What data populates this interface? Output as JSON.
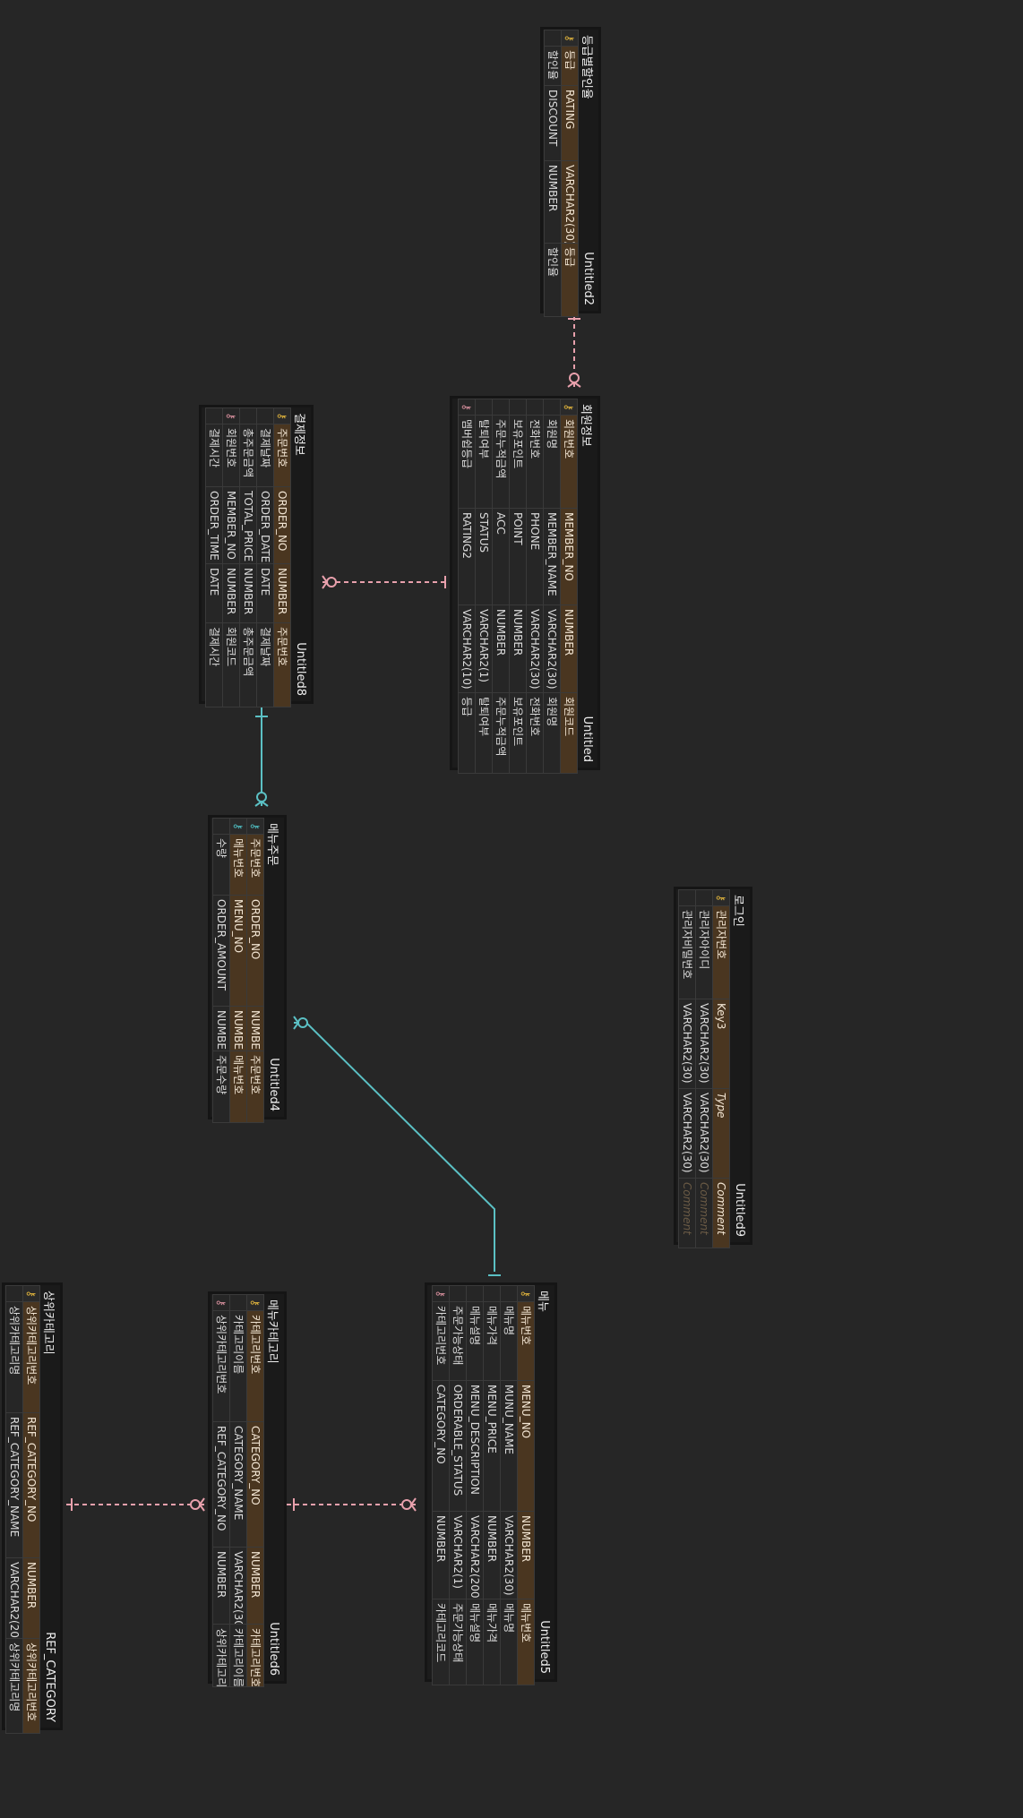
{
  "colors": {
    "background": "#262626",
    "pk_row": "#4a3620",
    "link_pink": "#e8a0ac",
    "link_teal": "#5bc0c4"
  },
  "entities": {
    "rating": {
      "title": "등급별할인율",
      "label": "Untitled2",
      "rows": [
        {
          "key": "key-gold",
          "col1": "등급",
          "col2": "RATING",
          "col3": "VARCHAR2(30)",
          "col4": "등급",
          "pk": true
        },
        {
          "key": "",
          "col1": "할인율",
          "col2": "DISCOUNT",
          "col3": "NUMBER",
          "col4": "할인율",
          "pk": false
        }
      ]
    },
    "member": {
      "title": "회원정보",
      "label": "Untitled",
      "rows": [
        {
          "key": "key-gold",
          "col1": "회원번호",
          "col2": "MEMBER_NO",
          "col3": "NUMBER",
          "col4": "회원코드",
          "pk": true
        },
        {
          "key": "",
          "col1": "회원명",
          "col2": "MEMBER_NAME",
          "col3": "VARCHAR2(30)",
          "col4": "회원명",
          "pk": false
        },
        {
          "key": "",
          "col1": "전화번호",
          "col2": "PHONE",
          "col3": "VARCHAR2(30)",
          "col4": "전화번호",
          "pk": false
        },
        {
          "key": "",
          "col1": "보유포인트",
          "col2": "POINT",
          "col3": "NUMBER",
          "col4": "보유포인트",
          "pk": false
        },
        {
          "key": "",
          "col1": "주문누적금액",
          "col2": "ACC",
          "col3": "NUMBER",
          "col4": "주문누적금액",
          "pk": false
        },
        {
          "key": "",
          "col1": "탈퇴여부",
          "col2": "STATUS",
          "col3": "VARCHAR2(1)",
          "col4": "탈퇴여부",
          "pk": false
        },
        {
          "key": "key-pink",
          "col1": "멤버쉽등급",
          "col2": "RATING2",
          "col3": "VARCHAR2(10)",
          "col4": "등급",
          "pk": false
        }
      ]
    },
    "payment": {
      "title": "결제정보",
      "label": "Untitled8",
      "rows": [
        {
          "key": "key-gold",
          "col1": "주문번호",
          "col2": "ORDER_NO",
          "col3": "NUMBER",
          "col4": "주문번호",
          "pk": true
        },
        {
          "key": "",
          "col1": "결제날짜",
          "col2": "ORDER_DATE",
          "col3": "DATE",
          "col4": "결제날짜",
          "pk": false
        },
        {
          "key": "",
          "col1": "총주문금액",
          "col2": "TOTAL_PRICE",
          "col3": "NUMBER",
          "col4": "총주문금액",
          "pk": false
        },
        {
          "key": "key-pink",
          "col1": "회원번호",
          "col2": "MEMBER_NO",
          "col3": "NUMBER",
          "col4": "회원코드",
          "pk": false
        },
        {
          "key": "",
          "col1": "결제시간",
          "col2": "ORDER_TIME",
          "col3": "DATE",
          "col4": "결제시간",
          "pk": false
        }
      ]
    },
    "menu_order": {
      "title": "메뉴주문",
      "label": "Untitled4",
      "rows": [
        {
          "key": "key-teal",
          "col1": "주문번호",
          "col2": "ORDER_NO",
          "col3": "NUMBER",
          "col4": "주문번호",
          "pk": true
        },
        {
          "key": "key-teal",
          "col1": "메뉴번호",
          "col2": "MENU_NO",
          "col3": "NUMBER",
          "col4": "메뉴번호",
          "pk": true
        },
        {
          "key": "",
          "col1": "수량",
          "col2": "ORDER_AMOUNT",
          "col3": "NUMBER",
          "col4": "주문수량",
          "pk": false
        }
      ]
    },
    "login": {
      "title": "로그인",
      "label": "Untitled9",
      "rows": [
        {
          "key": "key-gold",
          "col1": "관리자번호",
          "col2": "Key3",
          "col3": "Type",
          "col4": "Comment",
          "pk": true,
          "ph3": true,
          "ph4": true
        },
        {
          "key": "",
          "col1": "관리자아이디",
          "col2": "VARCHAR2(30)",
          "col3": "VARCHAR2(30)",
          "col4": "Comment",
          "pk": false,
          "ph4": true
        },
        {
          "key": "",
          "col1": "관리자비밀번호",
          "col2": "VARCHAR2(30)",
          "col3": "VARCHAR2(30)",
          "col4": "Comment",
          "pk": false,
          "ph4": true
        }
      ]
    },
    "menu": {
      "title": "메뉴",
      "label": "Untitled5",
      "rows": [
        {
          "key": "key-gold",
          "col1": "메뉴번호",
          "col2": "MENU_NO",
          "col3": "NUMBER",
          "col4": "메뉴번호",
          "pk": true
        },
        {
          "key": "",
          "col1": "메뉴명",
          "col2": "MUNU_NAME",
          "col3": "VARCHAR2(30)",
          "col4": "메뉴명",
          "pk": false
        },
        {
          "key": "",
          "col1": "메뉴가격",
          "col2": "MENU_PRICE",
          "col3": "NUMBER",
          "col4": "메뉴가격",
          "pk": false
        },
        {
          "key": "",
          "col1": "메뉴설명",
          "col2": "MENU_DESCRIPTION",
          "col3": "VARCHAR2(200)",
          "col4": "메뉴설명",
          "pk": false
        },
        {
          "key": "",
          "col1": "주문가능상태",
          "col2": "ORDERABLE_STATUS",
          "col3": "VARCHAR2(1)",
          "col4": "주문가능상태",
          "pk": false
        },
        {
          "key": "key-pink",
          "col1": "카테고리번호",
          "col2": "CATEGORY_NO",
          "col3": "NUMBER",
          "col4": "카테고리코드",
          "pk": false
        }
      ]
    },
    "menu_category": {
      "title": "메뉴카테고리",
      "label": "Untitled6",
      "rows": [
        {
          "key": "key-gold",
          "col1": "카테고리번호",
          "col2": "CATEGORY_NO",
          "col3": "NUMBER",
          "col4": "카테고리번호",
          "pk": true
        },
        {
          "key": "",
          "col1": "카테고리이름",
          "col2": "CATEGORY_NAME",
          "col3": "VARCHAR2(30)",
          "col4": "카테고리이름",
          "pk": false
        },
        {
          "key": "key-pink",
          "col1": "상위카테고리번호",
          "col2": "REF_CATEGORY_NO",
          "col3": "NUMBER",
          "col4": "상위카테고리번호",
          "pk": false
        }
      ]
    },
    "ref_category": {
      "title": "상위카테고리",
      "label": "REF_CATEGORY",
      "rows": [
        {
          "key": "key-gold",
          "col1": "상위카테고리번호",
          "col2": "REF_CATEGORY_NO",
          "col3": "NUMBER",
          "col4": "상위카테고리번호",
          "pk": true
        },
        {
          "key": "",
          "col1": "상위카테고리명",
          "col2": "REF_CATEGORY_NAME",
          "col3": "VARCHAR2(20)",
          "col4": "상위카테고리명",
          "pk": false
        }
      ]
    }
  },
  "relationships": [
    {
      "from": "rating",
      "to": "member",
      "style": "one-to-zero-or-many",
      "color": "#e8a0ac"
    },
    {
      "from": "member",
      "to": "payment",
      "style": "one-to-zero-or-many",
      "color": "#e8a0ac"
    },
    {
      "from": "payment",
      "to": "menu_order",
      "style": "one-to-zero-or-many",
      "color": "#5bc0c4"
    },
    {
      "from": "menu",
      "to": "menu_order",
      "style": "one-to-zero-or-many",
      "color": "#5bc0c4"
    },
    {
      "from": "menu_category",
      "to": "menu",
      "style": "one-to-zero-or-many",
      "color": "#e8a0ac"
    },
    {
      "from": "ref_category",
      "to": "menu_category",
      "style": "one-to-zero-or-many",
      "color": "#e8a0ac"
    }
  ]
}
